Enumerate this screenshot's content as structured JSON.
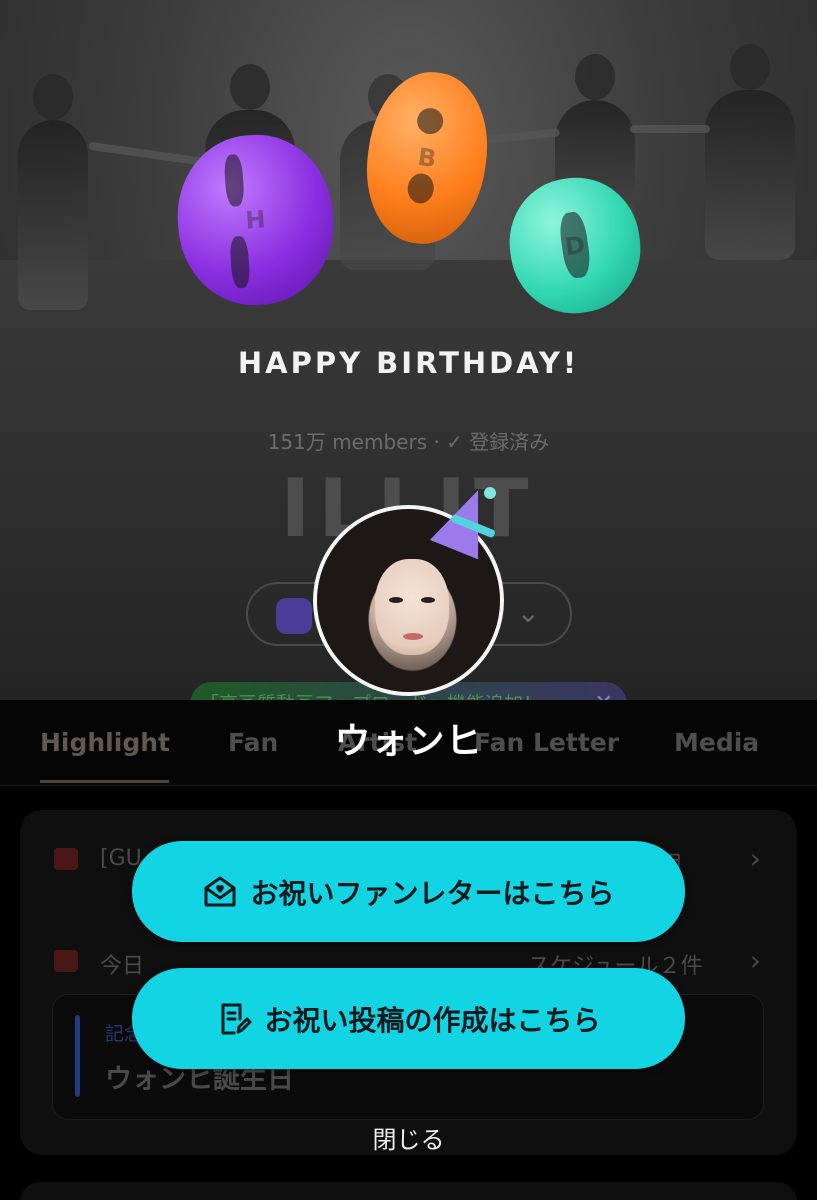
{
  "hero": {
    "hbd_letters": [
      "H",
      "B",
      "D"
    ],
    "banner_text": "HAPPY BIRTHDAY!",
    "members_text": "151万 members · ✓ 登録済み",
    "brand_name": "ILLIT"
  },
  "notice": {
    "text": "「高画質動画アップロード」機能追加！",
    "close_glyph": "✕"
  },
  "tabs": {
    "items": [
      {
        "label": "Highlight",
        "active": true
      },
      {
        "label": "Fan"
      },
      {
        "label": "Artist"
      },
      {
        "label": "Fan Letter"
      },
      {
        "label": "Media"
      }
    ]
  },
  "card": {
    "announcement": "[GU",
    "announcement_suffix": "用",
    "today_label": "今日",
    "schedule_count": "スケジュール２件",
    "schedule_category": "記念",
    "schedule_title": "ウォンヒ誕生日"
  },
  "popup": {
    "member_name": "ウォンヒ",
    "fan_letter_button": "お祝いファンレターはこちら",
    "post_button": "お祝い投稿の作成はこちら",
    "close_label": "閉じる",
    "icons": {
      "fan_letter": "letter-heart-icon",
      "post": "document-edit-icon"
    }
  },
  "colors": {
    "cta_background": "#12d4e3",
    "hbd_h": "#8a2fe0",
    "hbd_b": "#ff7e1c",
    "hbd_d": "#33d8b3"
  }
}
